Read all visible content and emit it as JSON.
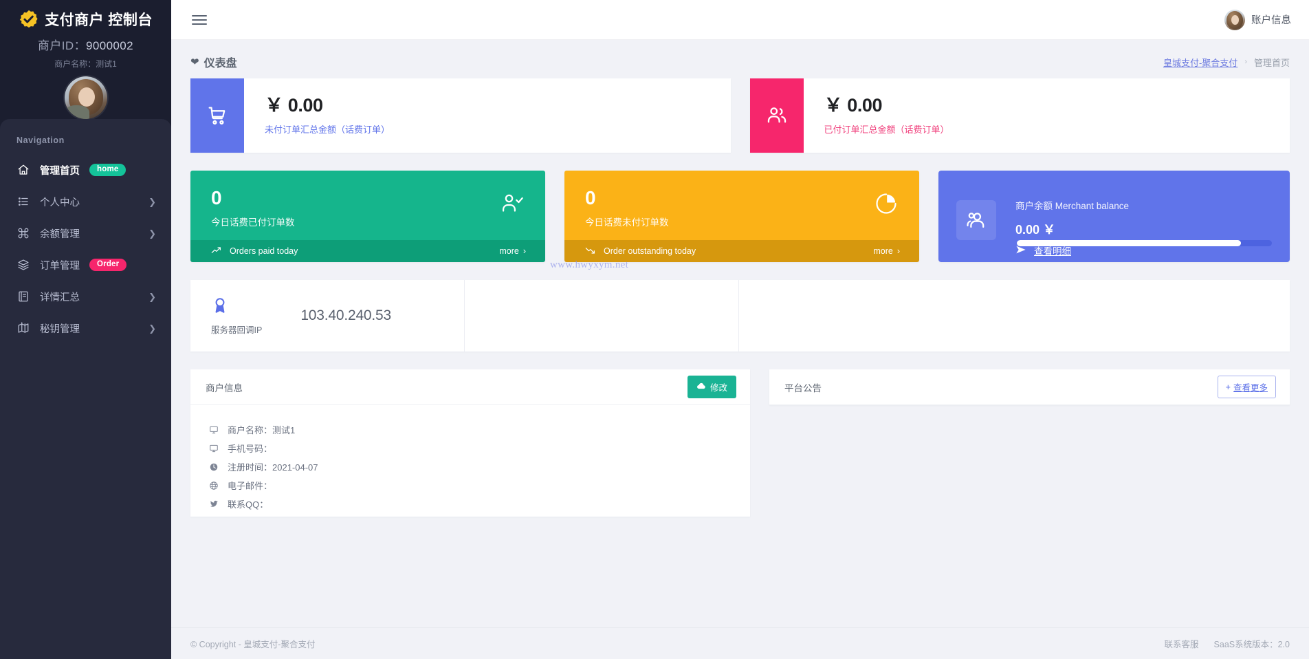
{
  "sidebar": {
    "brand_title": "支付商户 控制台",
    "logo_icon": "verified-badge-icon",
    "merchant_id_label": "商户ID：",
    "merchant_id_value": "9000002",
    "merchant_name_line": "商户名称：测试1",
    "nav_heading": "Navigation",
    "items": [
      {
        "label": "管理首页",
        "icon": "home-icon",
        "badge": "home",
        "badge_type": "home",
        "chevron": false,
        "active": true
      },
      {
        "label": "个人中心",
        "icon": "list-icon",
        "badge": "",
        "badge_type": "",
        "chevron": true,
        "active": false
      },
      {
        "label": "余额管理",
        "icon": "command-icon",
        "badge": "",
        "badge_type": "",
        "chevron": true,
        "active": false
      },
      {
        "label": "订单管理",
        "icon": "layers-icon",
        "badge": "Order",
        "badge_type": "order",
        "chevron": false,
        "active": false
      },
      {
        "label": "详情汇总",
        "icon": "book-icon",
        "badge": "",
        "badge_type": "",
        "chevron": true,
        "active": false
      },
      {
        "label": "秘钥管理",
        "icon": "map-icon",
        "badge": "",
        "badge_type": "",
        "chevron": true,
        "active": false
      }
    ]
  },
  "topbar": {
    "menu_icon": "hamburger-icon",
    "account_label": "账户信息",
    "avatar": "user-avatar"
  },
  "page": {
    "title": "仪表盘",
    "title_icon": "heart-icon",
    "breadcrumb_link": "皇城支付-聚合支付",
    "breadcrumb_sep": "›",
    "breadcrumb_current": "管理首页"
  },
  "money_cards": [
    {
      "icon": "shopping-cart-icon",
      "accent": "#6074ea",
      "value": "￥ 0.00",
      "label": "未付订单汇总金额（话费订单）"
    },
    {
      "icon": "users-icon",
      "accent": "#f6266c",
      "value": "￥ 0.00",
      "label": "已付订单汇总金额（话费订单）"
    }
  ],
  "tiles": [
    {
      "number": "0",
      "sub": "今日话费已付订单数",
      "icon": "user-check-icon",
      "foot_icon": "trend-up-icon",
      "foot_label": "Orders paid today",
      "more_label": "more",
      "more_chevron": "›",
      "color": "#15b58c",
      "foot_color": "#0d9e78"
    },
    {
      "number": "0",
      "sub": "今日话费未付订单数",
      "icon": "pie-chart-icon",
      "foot_icon": "trend-down-icon",
      "foot_label": "Order outstanding today",
      "more_label": "more",
      "more_chevron": "›",
      "color": "#fbb217",
      "foot_color": "#d6980e"
    }
  ],
  "balance": {
    "icon": "people-icon",
    "title": "商户余额 Merchant balance",
    "amount": "0.00 ￥",
    "link_icon": "send-icon",
    "link_label": "查看明细",
    "progress_percent": 88,
    "color": "#6074ea"
  },
  "ip_card": {
    "icon": "award-icon",
    "value": "103.40.240.53",
    "caption": "服务器回调IP",
    "watermark": "www.hwyxym.net"
  },
  "merchant_panel": {
    "title": "商户信息",
    "edit_icon": "cloud-icon",
    "edit_label": "修改",
    "rows": [
      {
        "icon": "monitor-icon",
        "text": "商户名称：测试1"
      },
      {
        "icon": "monitor-icon",
        "text": "手机号码："
      },
      {
        "icon": "clock-icon",
        "text": "注册时间：2021-04-07"
      },
      {
        "icon": "globe-icon",
        "text": "电子邮件："
      },
      {
        "icon": "twitter-icon",
        "text": "联系QQ："
      }
    ]
  },
  "notice_panel": {
    "title": "平台公告",
    "more_plus": "+",
    "more_label": "查看更多"
  },
  "footer": {
    "copyright": "© Copyright - 皇城支付-聚合支付",
    "support_label": "联系客服",
    "version_label": "SaaS系统版本：2.0"
  }
}
